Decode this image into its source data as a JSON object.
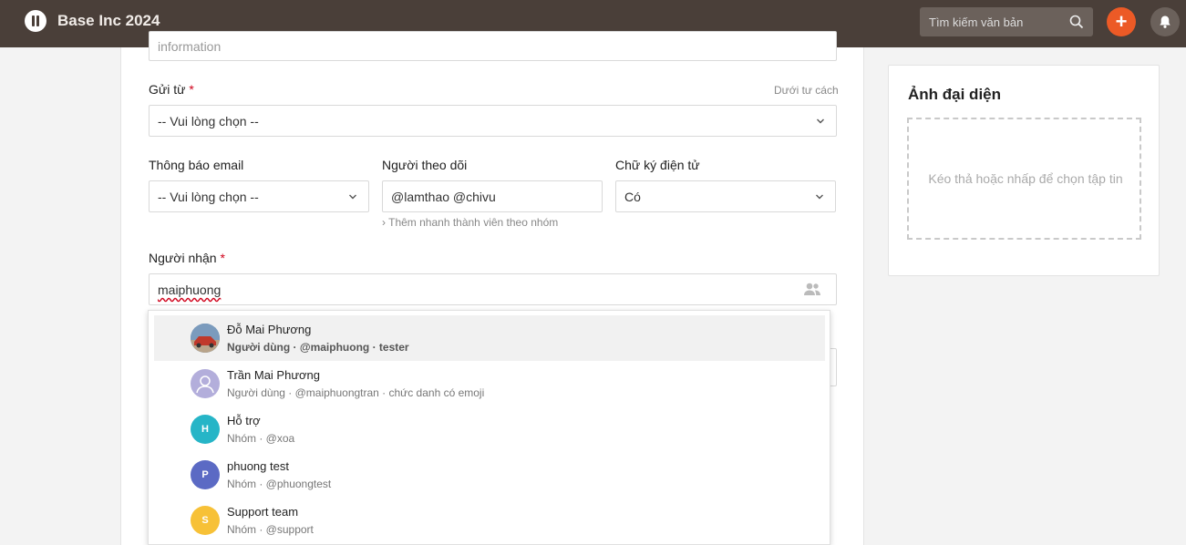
{
  "app": {
    "title": "Base Inc 2024"
  },
  "header": {
    "search_placeholder": "Tìm kiếm văn bản",
    "plus_label": "+"
  },
  "form": {
    "top_field_value": "information",
    "send_from": {
      "label": "Gửi từ",
      "required_mark": "*",
      "link": "Dưới tư cách",
      "value": "-- Vui lòng chọn --"
    },
    "email_notify": {
      "label": "Thông báo email",
      "value": "-- Vui lòng chọn --"
    },
    "followers": {
      "label": "Người theo dõi",
      "value": "@lamthao @chivu",
      "hint": "› Thêm nhanh thành viên theo nhóm"
    },
    "e_signature": {
      "label": "Chữ ký điện tử",
      "value": "Có"
    },
    "recipient": {
      "label": "Người nhận",
      "required_mark": "*",
      "value": "maiphuong"
    }
  },
  "dropdown": {
    "options": [
      {
        "name": "Đỗ Mai Phương",
        "sub": "Người dùng · @maiphuong · tester",
        "avatar": "photo",
        "color": "#c0392b",
        "initial": ""
      },
      {
        "name": "Trần Mai Phương",
        "sub": "Người dùng · @maiphuongtran · chức danh có emoji",
        "avatar": "user-placeholder",
        "color": "#b3aedb",
        "initial": ""
      },
      {
        "name": "Hỗ trợ",
        "sub": "Nhóm · @xoa",
        "avatar": "initial",
        "color": "#26b5c7",
        "initial": "H"
      },
      {
        "name": "phuong test",
        "sub": "Nhóm · @phuongtest",
        "avatar": "initial",
        "color": "#5b6ac4",
        "initial": "P"
      },
      {
        "name": "Support team",
        "sub": "Nhóm · @support",
        "avatar": "initial",
        "color": "#f7c137",
        "initial": "S"
      }
    ]
  },
  "side": {
    "title": "Ảnh đại diện",
    "dropzone_text": "Kéo thả hoặc nhấp để chọn tập tin"
  },
  "colors": {
    "topbar": "#4a3f39",
    "accent": "#ec5a26",
    "required": "#d0021b"
  }
}
